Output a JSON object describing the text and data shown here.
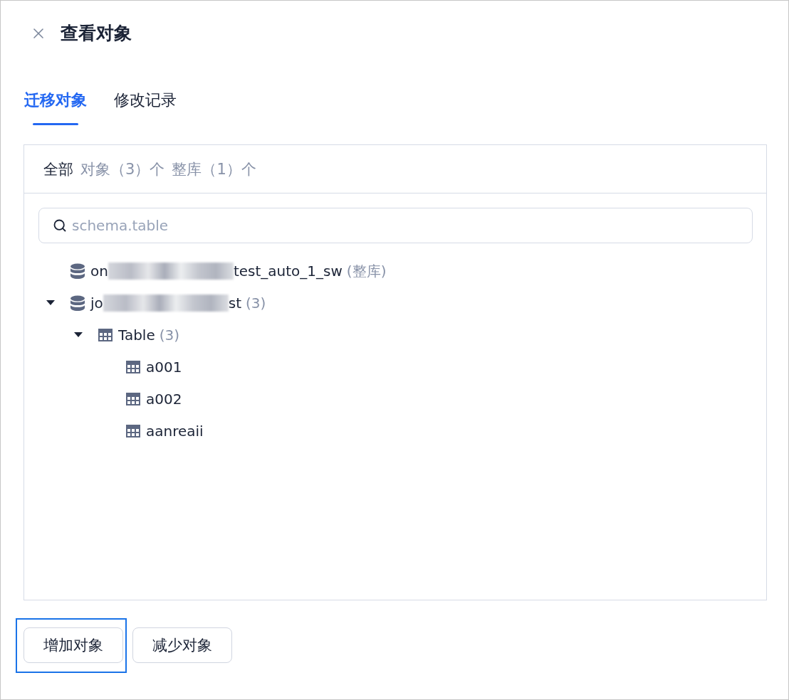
{
  "dialog": {
    "title": "查看对象"
  },
  "tabs": [
    {
      "label": "迁移对象",
      "selected": true
    },
    {
      "label": "修改记录",
      "selected": false
    }
  ],
  "objects_panel": {
    "filters": [
      {
        "label": "全部",
        "selected": true
      },
      {
        "label": "对象（3）个",
        "selected": false
      },
      {
        "label": "整库（1）个",
        "selected": false
      }
    ],
    "search": {
      "placeholder": "schema.table"
    },
    "tree": [
      {
        "kind": "database",
        "name": "on",
        "redacted": true,
        "name_end": "test_auto_1_sw",
        "count": "(整库)"
      },
      {
        "kind": "database",
        "name": "jo",
        "redacted": true,
        "name_end": "st",
        "count": "(3)",
        "expanded": true,
        "children": [
          {
            "kind": "group",
            "name": "Table",
            "count": "(3)",
            "expanded": true,
            "children": [
              {
                "kind": "table",
                "name": "a001"
              },
              {
                "kind": "table",
                "name": "a002"
              },
              {
                "kind": "table",
                "name": "aanreaii"
              }
            ]
          }
        ]
      }
    ]
  },
  "buttons": [
    {
      "label": "增加对象",
      "focused": true
    },
    {
      "label": "减少对象",
      "focused": false
    }
  ]
}
